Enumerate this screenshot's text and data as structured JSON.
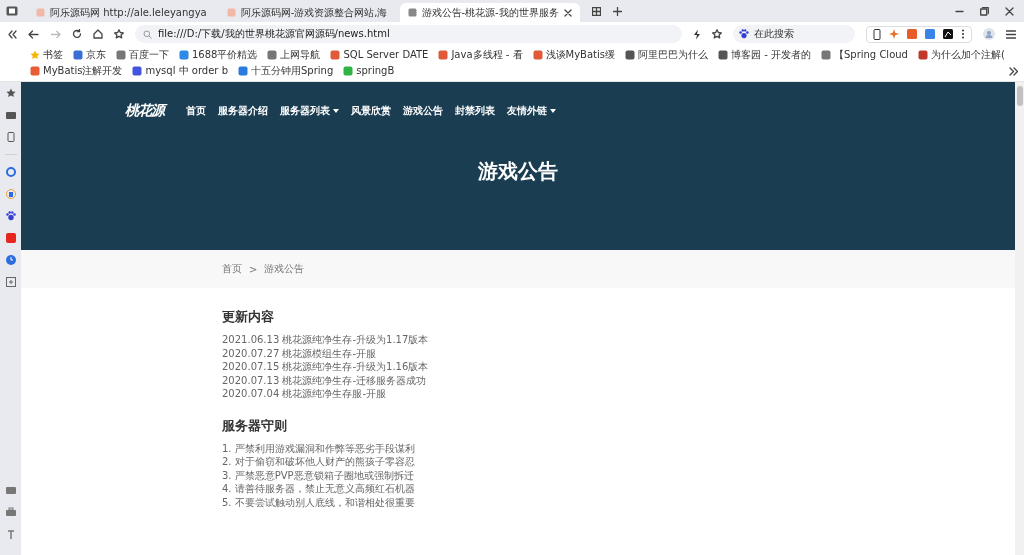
{
  "browser": {
    "tabs": [
      {
        "title": "阿乐源码网 http://ale.leleyangya",
        "selected": false
      },
      {
        "title": "阿乐源码网-游戏资源整合网站,海",
        "selected": false
      },
      {
        "title": "游戏公告-桃花源-我的世界服务",
        "selected": true
      }
    ],
    "address": "file:///D:/下载/我的世界桃花源官网源码/news.html",
    "search_placeholder": "在此搜索",
    "bookmarks": [
      "书签",
      "京东",
      "百度一下",
      "1688平价精选",
      "上网导航",
      "SQL Server DATE",
      "Java多线程 - 看",
      "浅谈MyBatis缓",
      "阿里巴巴为什么",
      "博客园 - 开发者的",
      "【Spring Cloud",
      "为什么加个注解(",
      "MyBatis注解开发",
      "mysql 中 order b",
      "十五分钟用Spring",
      "springB"
    ]
  },
  "site": {
    "logo": "桃花源",
    "nav": [
      {
        "label": "首页",
        "dropdown": false
      },
      {
        "label": "服务器介绍",
        "dropdown": false
      },
      {
        "label": "服务器列表",
        "dropdown": true
      },
      {
        "label": "风景欣赏",
        "dropdown": false
      },
      {
        "label": "游戏公告",
        "dropdown": false
      },
      {
        "label": "封禁列表",
        "dropdown": false
      },
      {
        "label": "友情外链",
        "dropdown": true
      }
    ],
    "hero_title": "游戏公告",
    "breadcrumb": {
      "items": [
        "首页",
        "游戏公告"
      ],
      "separator": ">"
    },
    "sections": [
      {
        "heading": "更新内容",
        "items": [
          "2021.06.13 桃花源纯净生存-升级为1.17版本",
          "2020.07.27 桃花源模组生存-开服",
          "2020.07.15 桃花源纯净生存-升级为1.16版本",
          "2020.07.13 桃花源纯净生存-迁移服务器成功",
          "2020.07.04 桃花源纯净生存服-开服"
        ]
      },
      {
        "heading": "服务器守则",
        "items": [
          "1. 严禁利用游戏漏洞和作弊等恶劣手段谋利",
          "2. 对于偷窃和破坏他人财产的熊孩子零容忍",
          "3. 严禁恶意PVP恶意锁箱子圈地或强制拆迁",
          "4. 请善待服务器，禁止无意义高频红石机器",
          "5. 不要尝试触动别人底线，和谐相处很重要"
        ]
      }
    ]
  }
}
